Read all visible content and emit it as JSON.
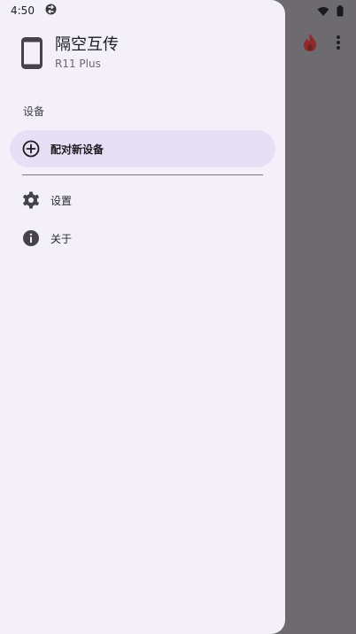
{
  "status_bar": {
    "time": "4:50"
  },
  "drawer": {
    "app_title": "隔空互传",
    "device_name": "R11 Plus",
    "section_title": "设备",
    "pair_new_device": "配对新设备",
    "settings": "设置",
    "about": "关于"
  },
  "icons": {
    "status_app": "sync-circle-icon",
    "wifi": "wifi-icon",
    "battery": "battery-icon",
    "phone": "smartphone-icon",
    "add": "add-circle-icon",
    "settings": "gear-icon",
    "about": "info-icon",
    "flame": "flame-icon",
    "more": "more-vert-icon"
  },
  "colors": {
    "drawer_bg": "#f4f0fa",
    "selected_bg": "#e7dff6",
    "scrim": "#6d6b70",
    "flame": "#8f2a2a"
  }
}
